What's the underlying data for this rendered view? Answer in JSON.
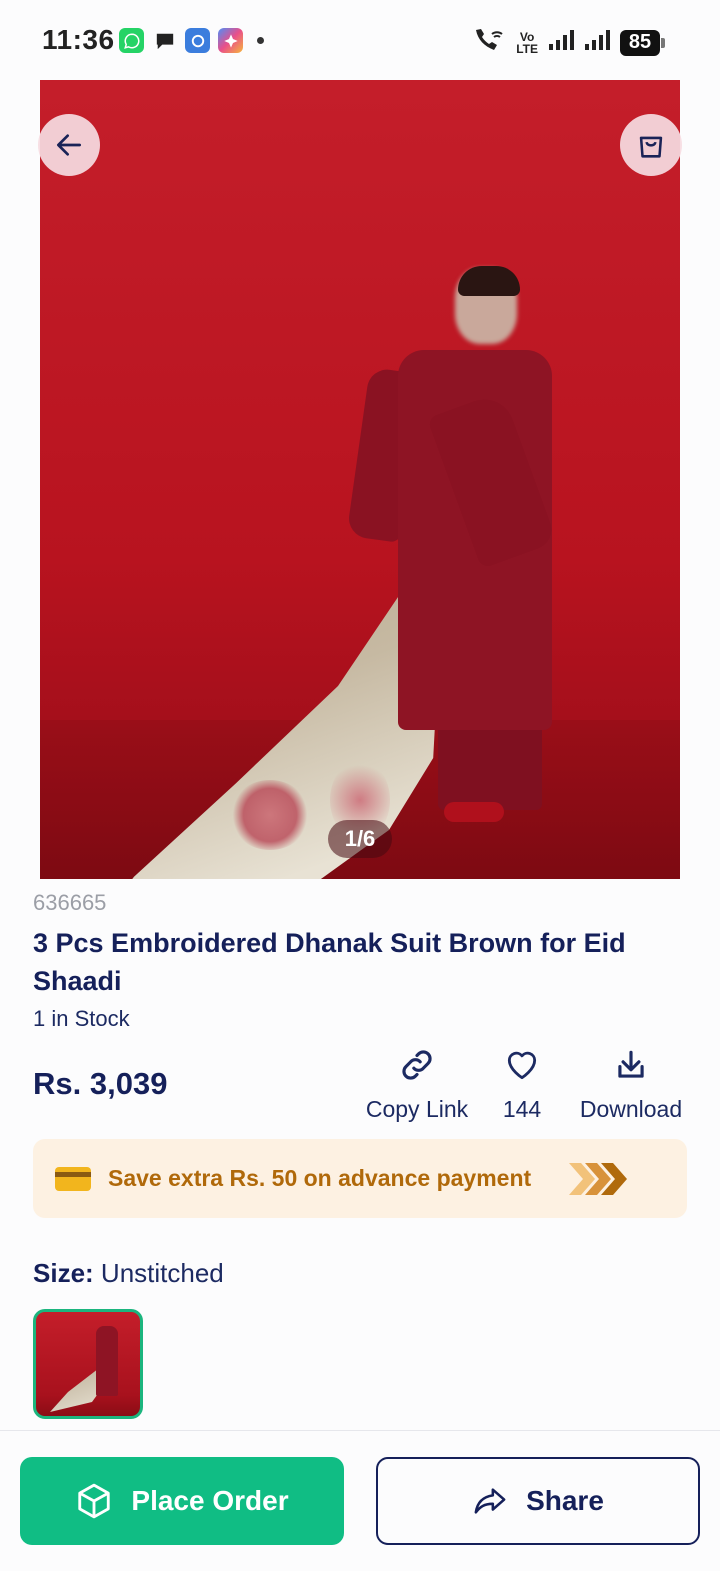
{
  "status_bar": {
    "time": "11:36",
    "volte_top": "Vo",
    "volte_bottom": "LTE",
    "battery": "85",
    "notification_icons": [
      "whatsapp-icon",
      "chat-icon",
      "sync-app-icon",
      "photos-app-icon"
    ]
  },
  "gallery": {
    "counter": "1/6"
  },
  "product": {
    "sku": "636665",
    "title": "3 Pcs Embroidered Dhanak Suit Brown for Eid Shaadi",
    "stock": "1 in Stock",
    "price": "Rs. 3,039"
  },
  "actions": {
    "copy_link": "Copy Link",
    "likes": "144",
    "download": "Download"
  },
  "promo": {
    "text": "Save extra Rs. 50 on advance payment"
  },
  "size": {
    "label": "Size:",
    "value": "Unstitched"
  },
  "bottom_bar": {
    "place_order": "Place Order",
    "share": "Share"
  },
  "colors": {
    "primary_green": "#10bd84",
    "navy": "#15205a",
    "promo_bg": "#fdf1e2",
    "promo_text": "#b0690a"
  }
}
